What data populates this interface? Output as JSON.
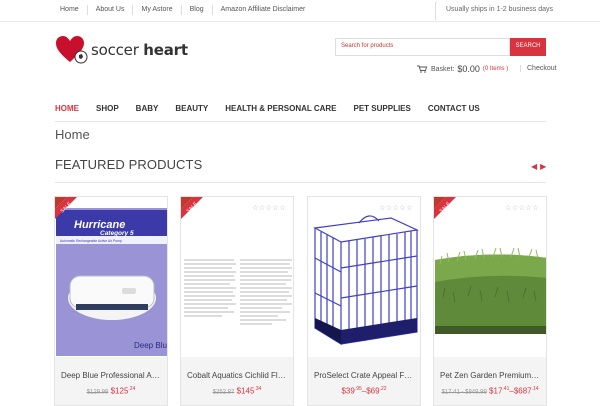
{
  "topbar": {
    "links": [
      "Home",
      "About Us",
      "My Astore",
      "Blog",
      "Amazon Affiliate Disclaimer"
    ],
    "ship_note": "Usually ships in 1-2 business days"
  },
  "logo": {
    "text_light": "soccer ",
    "text_bold": "heart"
  },
  "search": {
    "placeholder": "Search for products",
    "button": "SEARCH"
  },
  "basket": {
    "label": "Basket:",
    "amount": "$0.00",
    "items": "(0 Items )",
    "checkout": "Checkout"
  },
  "nav": [
    "HOME",
    "SHOP",
    "BABY",
    "BEAUTY",
    "HEALTH & PERSONAL CARE",
    "PET SUPPLIES",
    "CONTACT US"
  ],
  "breadcrumb": "Home",
  "section_title": "FEATURED PRODUCTS",
  "sale_label": "SALE",
  "products": [
    {
      "title": "Deep Blue Professional AD…",
      "old": "$129.99",
      "new_main": "$125",
      "new_cents": ".24",
      "sale": true,
      "image_text": [
        "Hurricane",
        "Category 5",
        "Automatic Rechargeable Active Air Pump",
        "Deep Blue"
      ]
    },
    {
      "title": "Cobalt Aquatics Cichlid Fla…",
      "old": "$252.87",
      "new_main": "$145",
      "new_cents": ".34",
      "sale": true
    },
    {
      "title": "ProSelect Crate Appeal Fas…",
      "old": "",
      "new_main": "$39",
      "new_cents": ".95",
      "range_main": "$69",
      "range_cents": ".22",
      "sale": false
    },
    {
      "title": "Pet Zen Garden Premium S…",
      "old": "$17.41 - $849.99",
      "new_main": "$17",
      "new_cents": ".41",
      "range_main": "$687",
      "range_cents": ".14",
      "sale": true
    }
  ],
  "colors": {
    "accent": "#d9333f"
  }
}
